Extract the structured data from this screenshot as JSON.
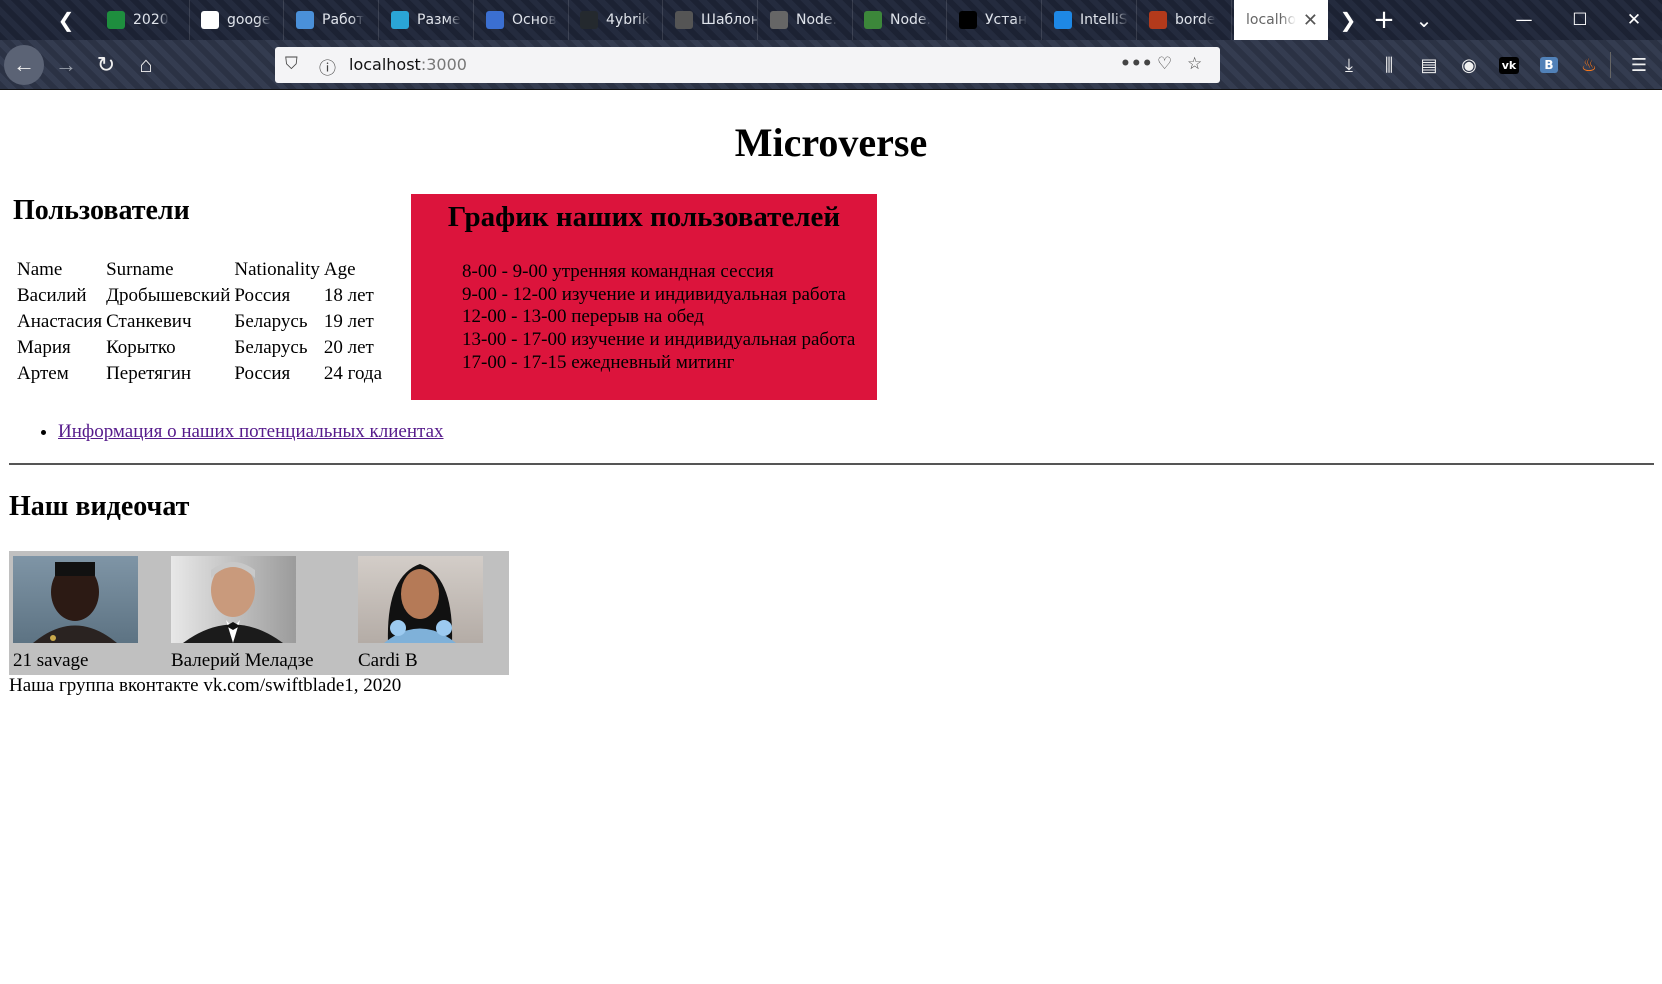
{
  "browser": {
    "tabs": [
      {
        "title": "2020",
        "icon": "sheets-icon",
        "color": "#1e8e3e"
      },
      {
        "title": "googe",
        "icon": "google-icon",
        "color": "#ffffff"
      },
      {
        "title": "Работ",
        "icon": "app-icon",
        "color": "#4a90d9"
      },
      {
        "title": "Разме",
        "icon": "gear-icon",
        "color": "#2aa5d6"
      },
      {
        "title": "Основ",
        "icon": "sync-icon",
        "color": "#3b6fd1"
      },
      {
        "title": "4ybrik",
        "icon": "github-icon",
        "color": "#24292e"
      },
      {
        "title": "Шаблони",
        "icon": "page-icon",
        "color": "#555555"
      },
      {
        "title": "Node.",
        "icon": "mail-icon",
        "color": "#666666"
      },
      {
        "title": "Node.",
        "icon": "node-icon",
        "color": "#3c873a"
      },
      {
        "title": "Устан",
        "icon": "ex-icon",
        "color": "#000000"
      },
      {
        "title": "IntelliS",
        "icon": "vscode-icon",
        "color": "#1e88e5"
      },
      {
        "title": "borde",
        "icon": "blocks-icon",
        "color": "#b33a1b"
      }
    ],
    "active_tab": {
      "title": "localho"
    },
    "url": {
      "host": "localhost",
      "port": ":3000"
    }
  },
  "page": {
    "title": "Microverse",
    "users_heading": "Пользователи",
    "table": {
      "headers": [
        "Name",
        "Surname",
        "Nationality",
        "Age"
      ],
      "rows": [
        [
          "Василий",
          "Дробышевский",
          "Россия",
          "18 лет"
        ],
        [
          "Анастасия",
          "Станкевич",
          "Беларусь",
          "19 лет"
        ],
        [
          "Мария",
          "Корытко",
          "Беларусь",
          "20 лет"
        ],
        [
          "Артем",
          "Перетягин",
          "Россия",
          "24 года"
        ]
      ]
    },
    "schedule": {
      "heading": "График наших пользователей",
      "items": [
        "8-00 - 9-00 утренняя командная сессия",
        "9-00 - 12-00 изучение и индивидуальная работа",
        "12-00 - 13-00 перерыв на обед",
        "13-00 - 17-00 изучение и индивидуальная работа",
        "17-00 - 17-15 ежедневный митинг"
      ],
      "background": "#dc143c"
    },
    "link_text": "Информация о наших потенциальных клиентах",
    "video_heading": "Наш видеочат",
    "videochat": [
      {
        "name": "21 savage"
      },
      {
        "name": "Валерий Меладзе"
      },
      {
        "name": "Cardi B"
      }
    ],
    "footer": "Наша группа вконтакте vk.com/swiftblade1, 2020"
  }
}
